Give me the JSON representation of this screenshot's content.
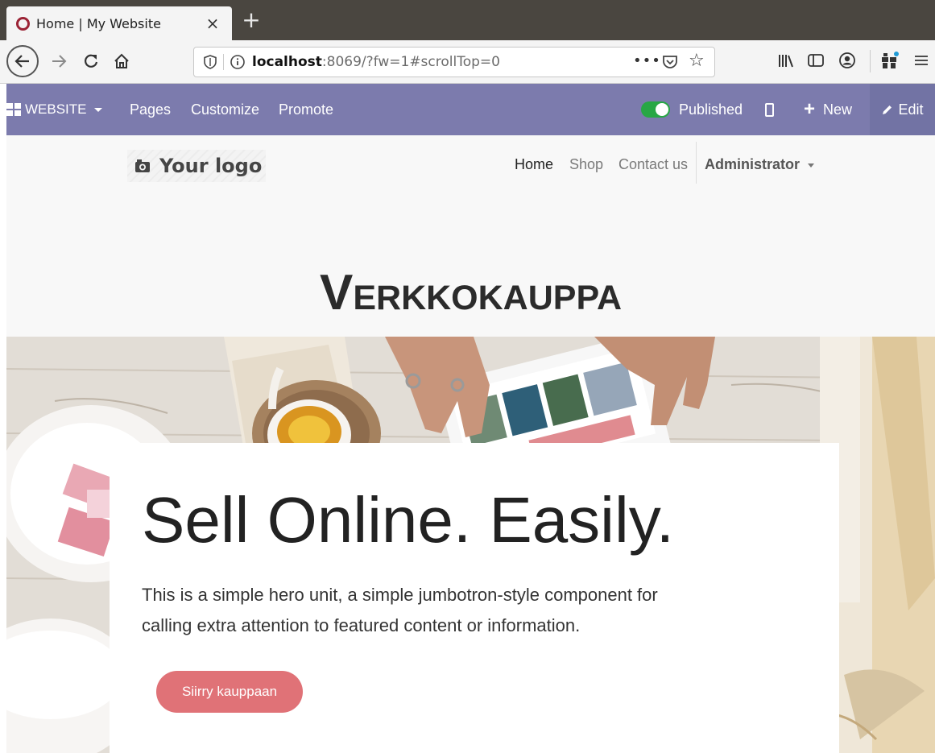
{
  "browser": {
    "tab_title": "Home | My Website",
    "tab_close": "×",
    "new_tab": "+",
    "url_host": "localhost",
    "url_rest": ":8069/?fw=1#scrollTop=0",
    "url_more": "•••"
  },
  "editor_bar": {
    "website_menu": "WEBSITE",
    "pages": "Pages",
    "customize": "Customize",
    "promote": "Promote",
    "published": "Published",
    "published_on": true,
    "new": "New",
    "edit": "Edit",
    "bar_color": "#7c7bad"
  },
  "site": {
    "logo_text": "Your logo",
    "nav": {
      "home": "Home",
      "shop": "Shop",
      "contact": "Contact us",
      "admin": "Administrator"
    },
    "page_heading": "Verkkokauppa"
  },
  "hero": {
    "title": "Sell Online. Easily.",
    "text": "This is a simple hero unit, a simple jumbotron-style component for calling extra attention to featured content or information.",
    "button_label": "Siirry kauppaan",
    "button_color": "#e07277"
  }
}
